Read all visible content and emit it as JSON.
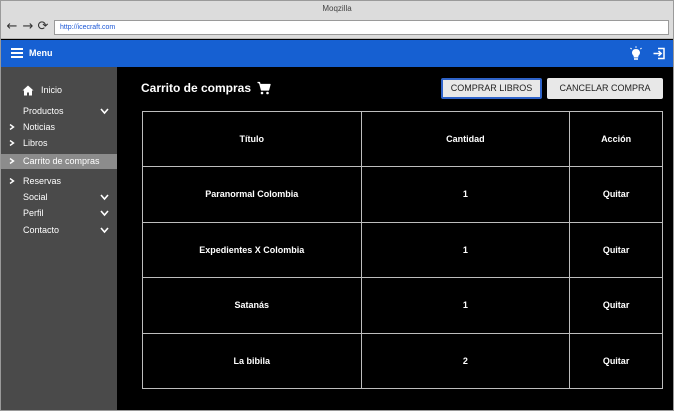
{
  "browser": {
    "window_title": "Moqzilla",
    "url": "http://icecraft.com"
  },
  "appbar": {
    "menu_label": "Menu",
    "icons": [
      "lightbulb-icon",
      "logout-icon"
    ],
    "color": "#1660d2"
  },
  "sidebar": {
    "items": [
      {
        "label": "Inicio",
        "icon": "home-icon",
        "active": false
      },
      {
        "label": "Productos",
        "icon": "chevron-down-icon",
        "active": false
      },
      {
        "label": "Noticias",
        "icon": "chevron-right-icon",
        "active": false
      },
      {
        "label": "Libros",
        "icon": "chevron-right-icon",
        "active": false
      },
      {
        "label": "Carrito de compras",
        "icon": "chevron-right-icon",
        "active": true
      },
      {
        "label": "Reservas",
        "icon": "chevron-right-icon",
        "active": false
      },
      {
        "label": "Social",
        "icon": "chevron-down-icon",
        "active": false
      },
      {
        "label": "Perfil",
        "icon": "chevron-down-icon",
        "active": false
      },
      {
        "label": "Contacto",
        "icon": "chevron-down-icon",
        "active": false
      }
    ]
  },
  "main": {
    "title": "Carrito de compras",
    "buttons": {
      "comprar": "COMPRAR LIBROS",
      "cancelar": "CANCELAR COMPRA"
    },
    "table": {
      "headers": [
        "Título",
        "Cantidad",
        "Acción"
      ],
      "rows": [
        {
          "titulo": "Paranormal Colombia",
          "cantidad": "1",
          "accion": "Quitar"
        },
        {
          "titulo": "Expedientes X Colombia",
          "cantidad": "1",
          "accion": "Quitar"
        },
        {
          "titulo": "Satanás",
          "cantidad": "1",
          "accion": "Quitar"
        },
        {
          "titulo": "La bibila",
          "cantidad": "2",
          "accion": "Quitar"
        }
      ]
    }
  }
}
